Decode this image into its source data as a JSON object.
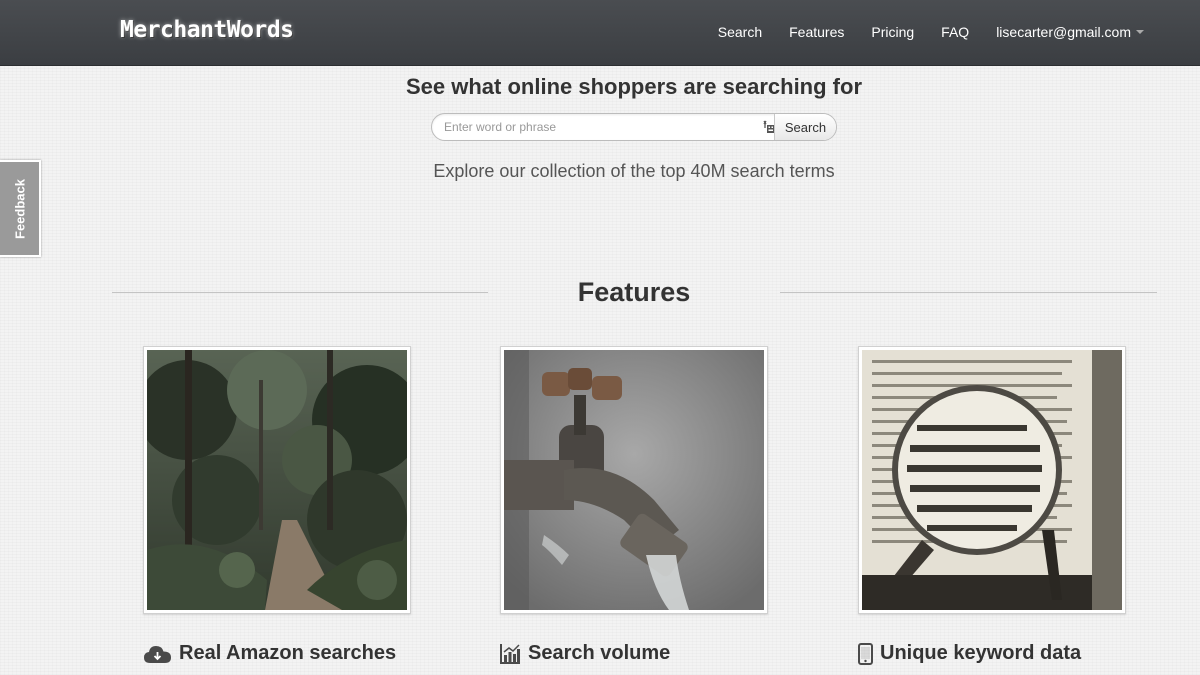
{
  "brand": "MerchantWords",
  "nav": {
    "items": [
      "Search",
      "Features",
      "Pricing",
      "FAQ"
    ],
    "account": "lisecarter@gmail.com"
  },
  "hero": {
    "title": "See what online shoppers are searching for",
    "placeholder": "Enter word or phrase",
    "search_button": "Search",
    "subtitle": "Explore our collection of the top 40M search terms"
  },
  "feedback_tab": "Feedback",
  "features": {
    "title": "Features",
    "cards": [
      {
        "title": "Real Amazon searches",
        "icon": "cloud-icon",
        "image": "forest-path-photo"
      },
      {
        "title": "Search volume",
        "icon": "bar-chart-icon",
        "image": "water-faucet-photo"
      },
      {
        "title": "Unique keyword data",
        "icon": "mobile-phone-icon",
        "image": "magnifying-glass-book-photo"
      }
    ]
  }
}
